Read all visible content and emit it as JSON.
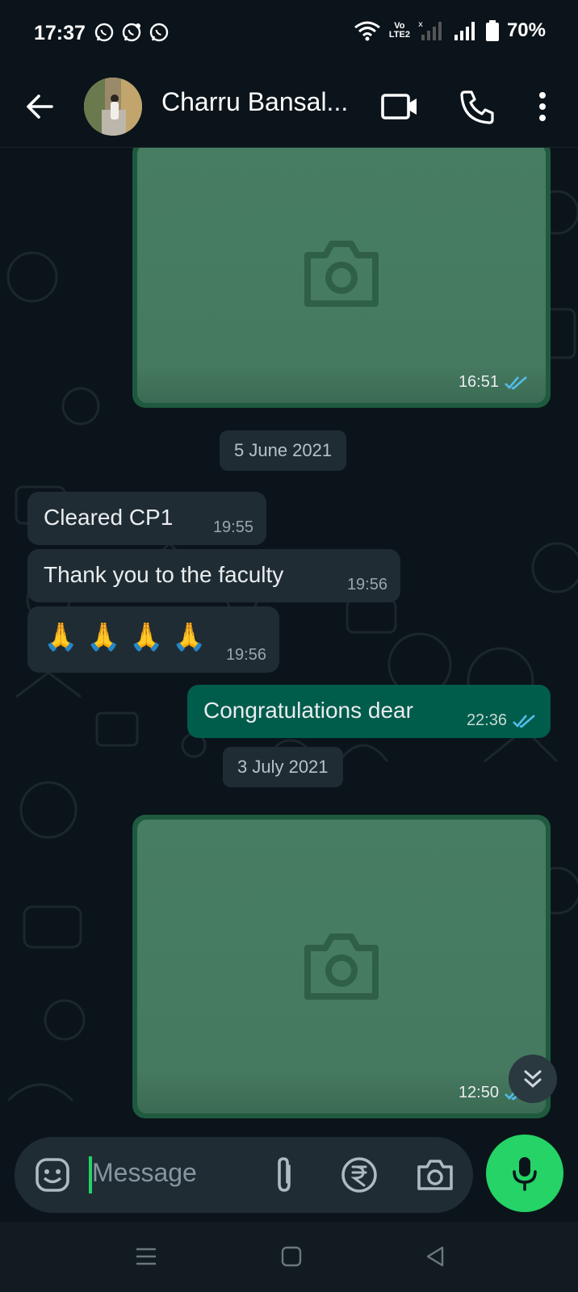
{
  "status_bar": {
    "time": "17:37",
    "network_label_top": "Vo",
    "network_label_bottom": "LTE2",
    "battery": "70%",
    "app_icons": [
      "whatsapp-icon",
      "whatsapp-business-icon",
      "whatsapp-icon"
    ]
  },
  "header": {
    "contact_name": "Charru Bansal...",
    "icons": [
      "back-arrow-icon",
      "video-call-icon",
      "phone-icon",
      "more-vert-icon"
    ]
  },
  "messages": {
    "image_1": {
      "time": "16:51",
      "status": "read"
    },
    "date_1": "5 June 2021",
    "in_1": {
      "text": "Cleared CP1",
      "time": "19:55"
    },
    "in_2": {
      "text": "Thank you to the faculty",
      "time": "19:56"
    },
    "in_3": {
      "text": "🙏 🙏 🙏 🙏",
      "time": "19:56"
    },
    "out_1": {
      "text": "Congratulations dear",
      "time": "22:36",
      "status": "read"
    },
    "date_2": "3 July 2021",
    "image_2": {
      "time": "12:50",
      "status": "read"
    }
  },
  "composer": {
    "placeholder": "Message",
    "icons": [
      "emoji-icon",
      "attach-icon",
      "rupee-icon",
      "camera-icon",
      "mic-icon"
    ]
  },
  "colors": {
    "background": "#0b141a",
    "incoming_bubble": "#202c33",
    "outgoing_bubble": "#005c4b",
    "accent_green": "#25d366",
    "read_ticks": "#53bdeb"
  }
}
